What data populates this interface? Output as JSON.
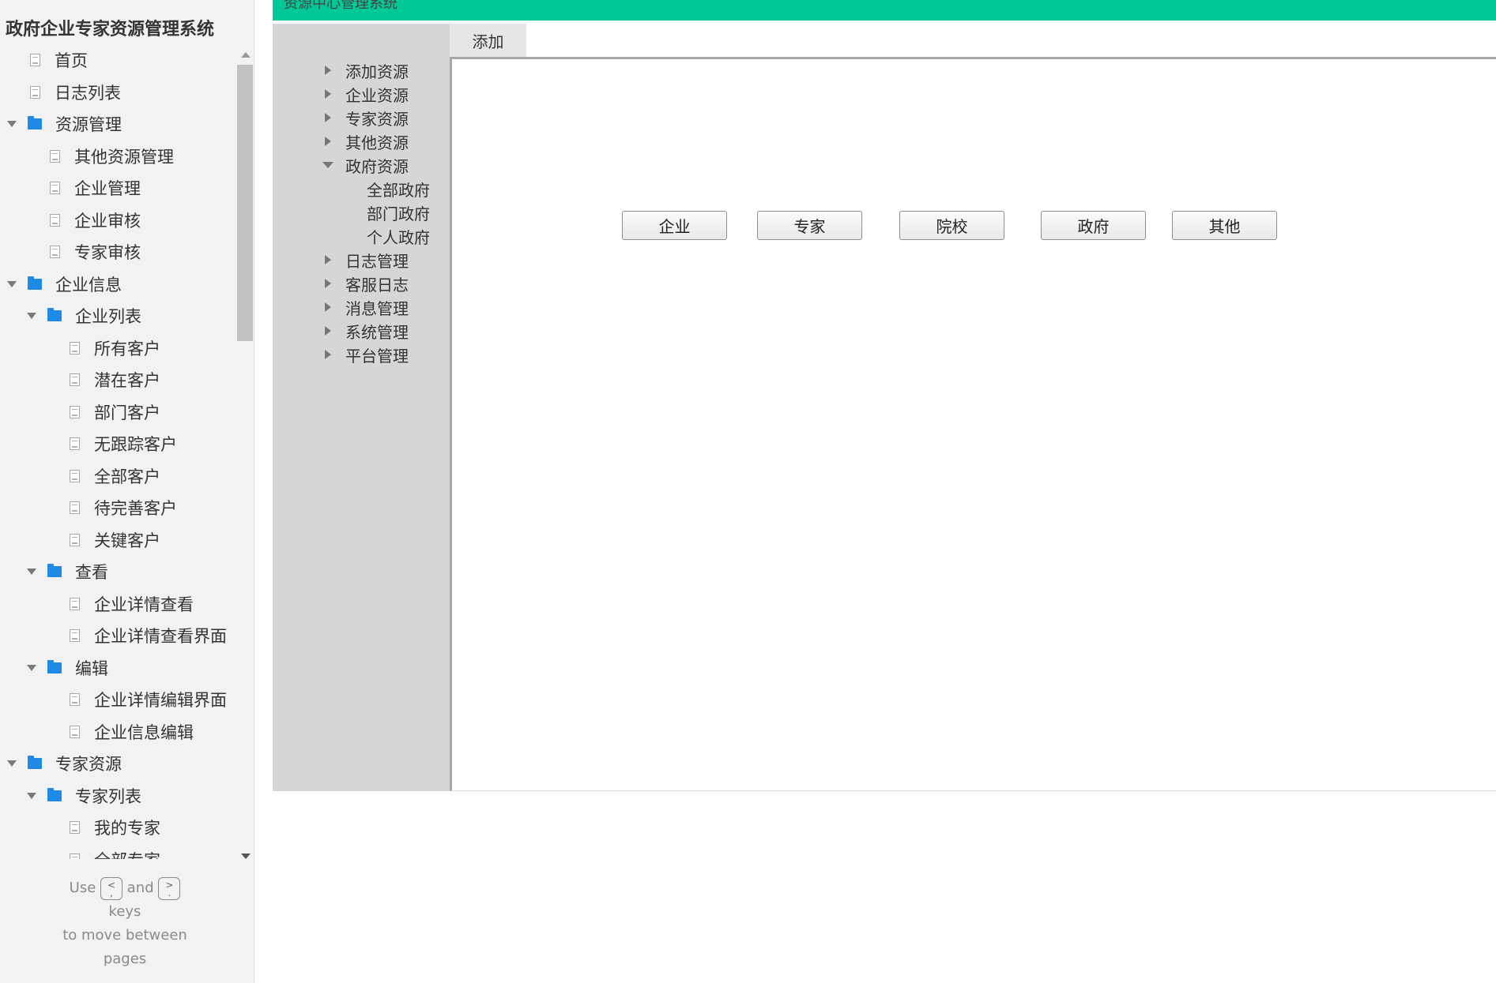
{
  "sidebar": {
    "title": "政府企业专家资源管理系统",
    "tree": [
      {
        "label": "首页",
        "level": 0,
        "type": "page",
        "arrow": "none"
      },
      {
        "label": "日志列表",
        "level": 0,
        "type": "page",
        "arrow": "none"
      },
      {
        "label": "资源管理",
        "level": 0,
        "type": "folder",
        "arrow": "down"
      },
      {
        "label": "其他资源管理",
        "level": 1,
        "type": "page",
        "arrow": "none"
      },
      {
        "label": "企业管理",
        "level": 1,
        "type": "page",
        "arrow": "none"
      },
      {
        "label": "企业审核",
        "level": 1,
        "type": "page",
        "arrow": "none"
      },
      {
        "label": "专家审核",
        "level": 1,
        "type": "page",
        "arrow": "none"
      },
      {
        "label": "企业信息",
        "level": 0,
        "type": "folder",
        "arrow": "down"
      },
      {
        "label": "企业列表",
        "level": 1,
        "type": "folder",
        "arrow": "down"
      },
      {
        "label": "所有客户",
        "level": 2,
        "type": "page",
        "arrow": "none"
      },
      {
        "label": "潜在客户",
        "level": 2,
        "type": "page",
        "arrow": "none"
      },
      {
        "label": "部门客户",
        "level": 2,
        "type": "page",
        "arrow": "none"
      },
      {
        "label": "无跟踪客户",
        "level": 2,
        "type": "page",
        "arrow": "none"
      },
      {
        "label": "全部客户",
        "level": 2,
        "type": "page",
        "arrow": "none"
      },
      {
        "label": "待完善客户",
        "level": 2,
        "type": "page",
        "arrow": "none"
      },
      {
        "label": "关键客户",
        "level": 2,
        "type": "page",
        "arrow": "none"
      },
      {
        "label": "查看",
        "level": 1,
        "type": "folder",
        "arrow": "down"
      },
      {
        "label": "企业详情查看",
        "level": 2,
        "type": "page",
        "arrow": "none"
      },
      {
        "label": "企业详情查看界面",
        "level": 2,
        "type": "page",
        "arrow": "none"
      },
      {
        "label": "编辑",
        "level": 1,
        "type": "folder",
        "arrow": "down"
      },
      {
        "label": "企业详情编辑界面",
        "level": 2,
        "type": "page",
        "arrow": "none"
      },
      {
        "label": "企业信息编辑",
        "level": 2,
        "type": "page",
        "arrow": "none"
      },
      {
        "label": "专家资源",
        "level": 0,
        "type": "folder",
        "arrow": "down"
      },
      {
        "label": "专家列表",
        "level": 1,
        "type": "folder",
        "arrow": "down"
      },
      {
        "label": "我的专家",
        "level": 2,
        "type": "page",
        "arrow": "none"
      },
      {
        "label": "全部专家",
        "level": 2,
        "type": "page",
        "arrow": "none"
      }
    ],
    "hint": {
      "use": "Use",
      "key_prev": "<",
      "key_prev_sub": ",",
      "and": "and",
      "key_next": ">",
      "key_next_sub": ".",
      "keys": "keys",
      "line3": "to move between",
      "line4": "pages"
    }
  },
  "header": {
    "title": "资源中心管理系统",
    "accent_color": "#00c896"
  },
  "inner_nav": {
    "items": [
      {
        "label": "添加资源",
        "expanded": false,
        "child": false
      },
      {
        "label": "企业资源",
        "expanded": false,
        "child": false
      },
      {
        "label": "专家资源",
        "expanded": false,
        "child": false
      },
      {
        "label": "其他资源",
        "expanded": false,
        "child": false
      },
      {
        "label": "政府资源",
        "expanded": true,
        "child": false
      },
      {
        "label": "全部政府",
        "expanded": false,
        "child": true
      },
      {
        "label": "部门政府",
        "expanded": false,
        "child": true
      },
      {
        "label": "个人政府",
        "expanded": false,
        "child": true
      },
      {
        "label": "日志管理",
        "expanded": false,
        "child": false
      },
      {
        "label": "客服日志",
        "expanded": false,
        "child": false
      },
      {
        "label": "消息管理",
        "expanded": false,
        "child": false
      },
      {
        "label": "系统管理",
        "expanded": false,
        "child": false
      },
      {
        "label": "平台管理",
        "expanded": false,
        "child": false
      }
    ]
  },
  "tab": {
    "label": "添加"
  },
  "buttons": [
    {
      "label": "企业"
    },
    {
      "label": "专家"
    },
    {
      "label": "院校"
    },
    {
      "label": "政府"
    },
    {
      "label": "其他"
    }
  ]
}
